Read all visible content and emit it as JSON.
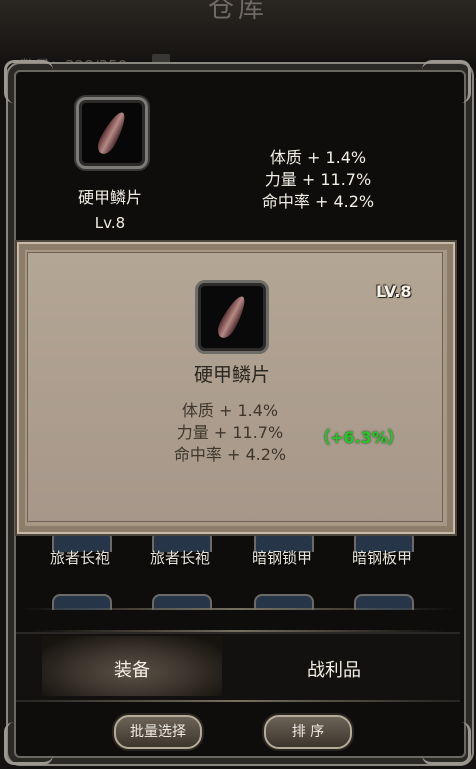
{
  "header": {
    "title": "仓库",
    "capacity": "数量：328/350"
  },
  "equipped": {
    "name": "硬甲鳞片",
    "level": "Lv.8",
    "stats": [
      "体质 + 1.4%",
      "力量 + 11.7%",
      "命中率 + 4.2%"
    ]
  },
  "detail": {
    "level": "LV.8",
    "name": "硬甲鳞片",
    "stats": [
      "体质 + 1.4%",
      "力量 + 11.7%",
      "命中率 + 4.2%"
    ],
    "bonus": "（+6.3%）"
  },
  "grid": {
    "row1": [
      "旅者长袍",
      "旅者长袍",
      "暗钢锁甲",
      "暗钢板甲"
    ]
  },
  "tabs": {
    "equip": "装备",
    "loot": "战利品"
  },
  "buttons": {
    "batch_select": "批量选择",
    "sort": "排 序"
  },
  "colors": {
    "bonus_green": "#2dc22d",
    "popup_bg": "#a79886"
  }
}
